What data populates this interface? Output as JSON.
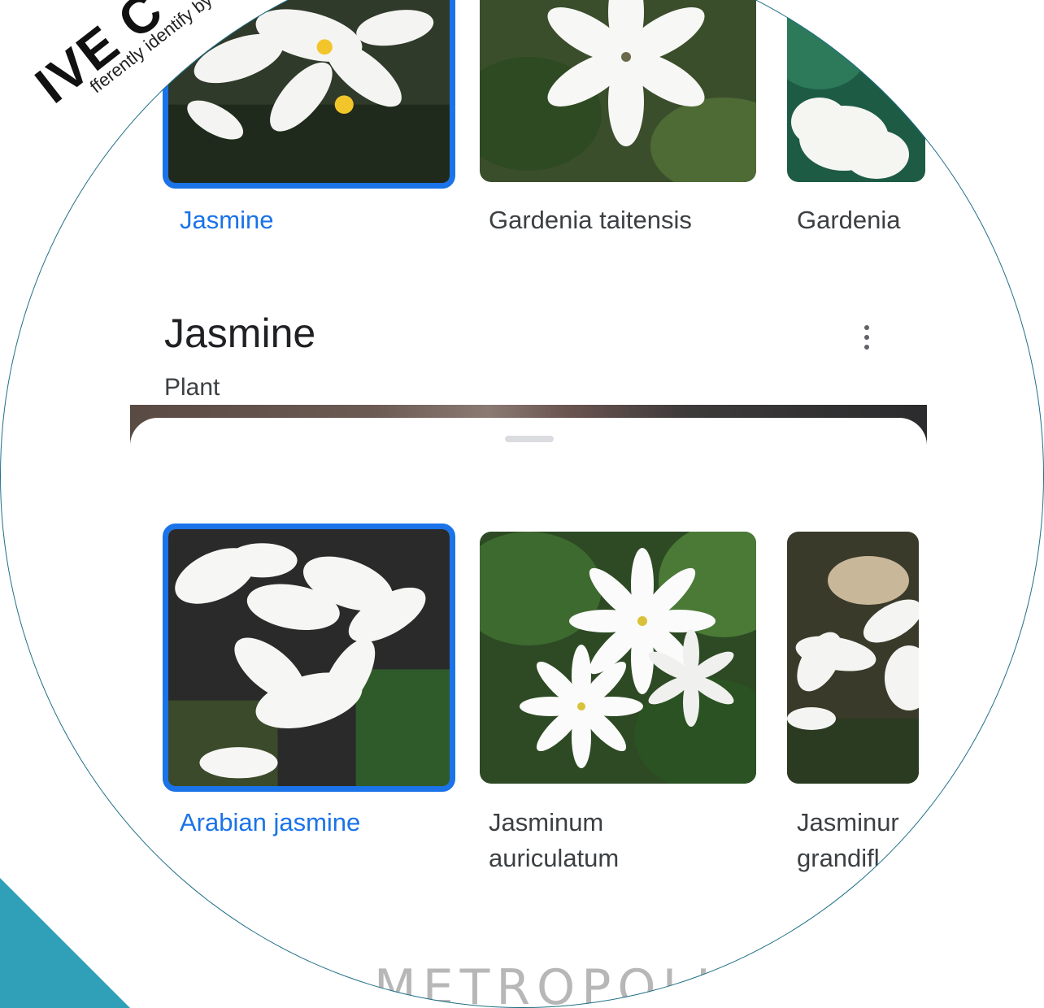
{
  "top_row": {
    "items": [
      {
        "label": "Jasmine",
        "selected": true
      },
      {
        "label": "Gardenia taitensis",
        "selected": false
      },
      {
        "label": "Gardenia",
        "selected": false
      }
    ]
  },
  "entity": {
    "title": "Jasmine",
    "subtitle": "Plant",
    "more_icon": "more-vert-icon"
  },
  "bottom_row": {
    "items": [
      {
        "label_line1": "Arabian jasmine",
        "label_line2": "",
        "selected": true
      },
      {
        "label_line1": "Jasminum",
        "label_line2": "auriculatum",
        "selected": false
      },
      {
        "label_line1": "Jasminur",
        "label_line2": "grandifl",
        "selected": false
      }
    ]
  },
  "overlay": {
    "stamp_large": "IVE C",
    "stamp_small": "fferently identify by",
    "watermark": "METROPOLIS"
  },
  "colors": {
    "accent": "#1a73e8",
    "text_primary": "#202124",
    "text_secondary": "#3c4043",
    "corner": "#2fa0b8"
  }
}
